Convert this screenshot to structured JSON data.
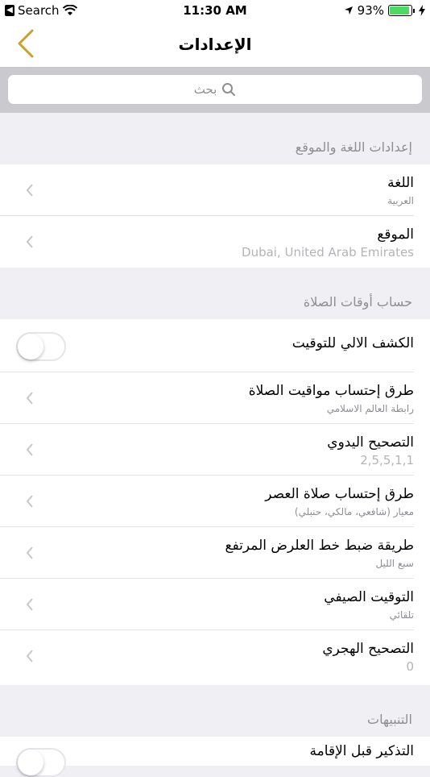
{
  "status_bar": {
    "back_app": "Search",
    "time": "11:30 AM",
    "battery": "93%",
    "battery_level": 0.93
  },
  "nav": {
    "title": "الإعدادات",
    "back_icon": "chevron-left-icon"
  },
  "search": {
    "placeholder": "بحث",
    "icon": "search-icon"
  },
  "sections": {
    "language_location": {
      "header": "إعدادات اللغة والموقع",
      "language": {
        "title": "اللغة",
        "value": "العربية"
      },
      "location": {
        "title": "الموقع",
        "value": "Dubai, United Arab Emirates"
      }
    },
    "prayer_calc": {
      "header": "حساب أوقات الصلاة",
      "auto_detect": {
        "title": "الكشف الالي للتوقيت",
        "on": false
      },
      "calc_method": {
        "title": "طرق إحتساب مواقيت الصلاة",
        "value": "رابطة العالم الاسلامي"
      },
      "manual_correction": {
        "title": "التصحيح اليدوي",
        "value": "2,5,5,1,1"
      },
      "asr_method": {
        "title": "طرق إحتساب صلاة العصر",
        "value": "معيار (شافعي، مالكي، حنبلي)"
      },
      "high_latitude": {
        "title": "طريقة ضبط خط العلرض المرتفع",
        "value": "سبع الليل"
      },
      "dst": {
        "title": "التوقيت الصيفي",
        "value": "تلقائي"
      },
      "hijri_correction": {
        "title": "التصحيح الهجري",
        "value": "0"
      }
    },
    "notifications": {
      "header": "التنبيهات",
      "iqama_reminder": {
        "title": "التذكير قبل الإقامة",
        "on": false
      }
    }
  },
  "colors": {
    "accent": "#c9a227",
    "background": "#efeff4",
    "search_bar_bg": "#c9c9ce",
    "secondary_text": "#8e8e93"
  }
}
